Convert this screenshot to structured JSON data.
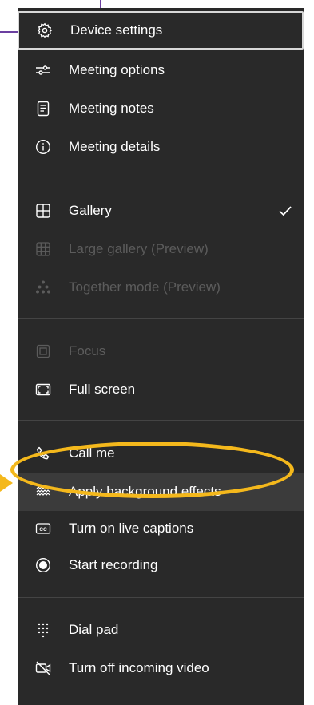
{
  "menu": {
    "items": [
      {
        "id": "device-settings",
        "label": "Device settings",
        "icon": "gear-icon",
        "disabled": false,
        "focused": true
      },
      {
        "id": "meeting-options",
        "label": "Meeting options",
        "icon": "sliders-icon",
        "disabled": false
      },
      {
        "id": "meeting-notes",
        "label": "Meeting notes",
        "icon": "notes-icon",
        "disabled": false
      },
      {
        "id": "meeting-details",
        "label": "Meeting details",
        "icon": "info-icon",
        "disabled": false
      },
      {
        "id": "gallery",
        "label": "Gallery",
        "icon": "gallery-icon",
        "disabled": false,
        "checked": true
      },
      {
        "id": "large-gallery",
        "label": "Large gallery (Preview)",
        "icon": "large-gallery-icon",
        "disabled": true
      },
      {
        "id": "together-mode",
        "label": "Together mode (Preview)",
        "icon": "together-mode-icon",
        "disabled": true
      },
      {
        "id": "focus",
        "label": "Focus",
        "icon": "focus-icon",
        "disabled": true
      },
      {
        "id": "full-screen",
        "label": "Full screen",
        "icon": "fullscreen-icon",
        "disabled": false
      },
      {
        "id": "call-me",
        "label": "Call me",
        "icon": "phone-icon",
        "disabled": false
      },
      {
        "id": "apply-background-effects",
        "label": "Apply background effects",
        "icon": "background-effects-icon",
        "disabled": false,
        "highlighted": true
      },
      {
        "id": "turn-on-live-captions",
        "label": "Turn on live captions",
        "icon": "captions-icon",
        "disabled": false
      },
      {
        "id": "start-recording",
        "label": "Start recording",
        "icon": "record-icon",
        "disabled": false
      },
      {
        "id": "dial-pad",
        "label": "Dial pad",
        "icon": "dialpad-icon",
        "disabled": false
      },
      {
        "id": "turn-off-incoming-video",
        "label": "Turn off incoming video",
        "icon": "video-off-icon",
        "disabled": false
      }
    ]
  },
  "colors": {
    "menu_background": "#292929",
    "hover_background": "#3b3b3b",
    "text": "#ffffff",
    "disabled_text": "#5c5c5c",
    "annotation_ellipse": "#f4b81c",
    "annotation_leader": "#6b3fa0"
  }
}
